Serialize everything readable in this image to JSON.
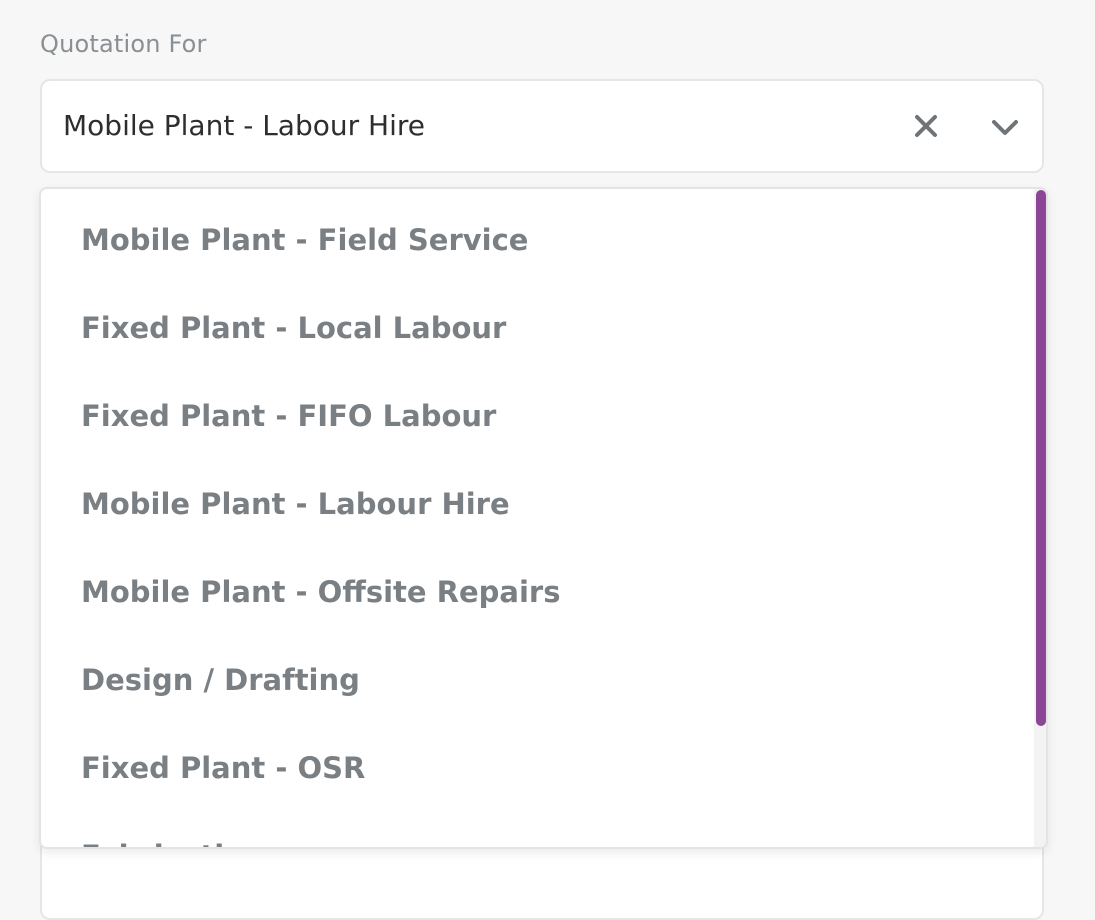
{
  "field": {
    "label": "Quotation For",
    "selected_value": "Mobile Plant - Labour Hire",
    "clear_icon": "close-icon",
    "toggle_icon": "chevron-down-icon"
  },
  "dropdown": {
    "options": [
      {
        "label": "Mobile Plant - Field Service"
      },
      {
        "label": "Fixed Plant - Local Labour"
      },
      {
        "label": "Fixed Plant - FIFO Labour"
      },
      {
        "label": "Mobile Plant - Labour Hire"
      },
      {
        "label": "Mobile Plant - Offsite Repairs"
      },
      {
        "label": "Design / Drafting"
      },
      {
        "label": "Fixed Plant - OSR"
      },
      {
        "label": "Fabrication"
      }
    ],
    "scrollbar_color": "#8b4695"
  }
}
